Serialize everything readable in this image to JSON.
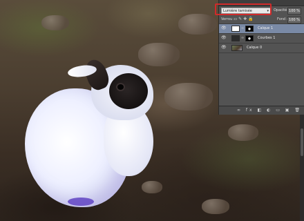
{
  "layers_panel": {
    "blend_mode": "Lumière tamisée",
    "opacity_label": "Opacité :",
    "opacity_value": "100 %",
    "lock_label": "Verrou :",
    "fill_label": "Fond :",
    "fill_value": "100 %",
    "layers": [
      {
        "name": "Calque 1",
        "thumbnail": "white-fill",
        "mask": true,
        "selected": true
      },
      {
        "name": "Courbes 1",
        "thumbnail": "adjustment",
        "mask": true,
        "selected": false
      },
      {
        "name": "Calque 0",
        "thumbnail": "photo",
        "mask": false,
        "selected": false
      }
    ]
  },
  "colors": {
    "highlight": "#d12a2a",
    "panel_bg": "#535353",
    "selected_layer": "#7a8aa6"
  }
}
